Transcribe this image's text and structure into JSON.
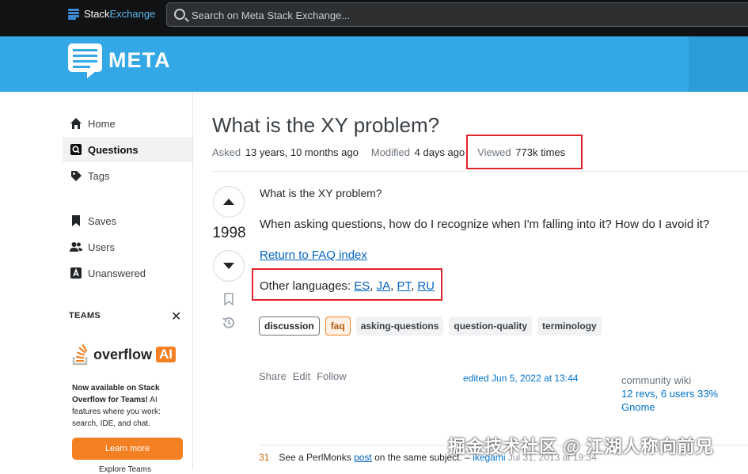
{
  "topbar": {
    "logo_stack": "Stack",
    "logo_exchange": "Exchange",
    "search_placeholder": "Search on Meta Stack Exchange..."
  },
  "banner": {
    "logo_text": "META"
  },
  "nav": {
    "items": [
      {
        "label": "Home",
        "icon": "home-icon"
      },
      {
        "label": "Questions",
        "icon": "questions-icon",
        "active": true
      },
      {
        "label": "Tags",
        "icon": "tag-icon"
      },
      {
        "label": "Saves",
        "icon": "bookmark-icon"
      },
      {
        "label": "Users",
        "icon": "users-icon"
      },
      {
        "label": "Unanswered",
        "icon": "unanswered-icon"
      }
    ],
    "teams_heading": "TEAMS",
    "overflow_word": "overflow",
    "overflow_ai": "AI",
    "teams_bold": "Now available on Stack Overflow for Teams!",
    "teams_body": " AI features where you work: search, IDE, and chat.",
    "learn_more": "Learn more",
    "explore": "Explore Teams"
  },
  "question": {
    "title": "What is the XY problem?",
    "asked_label": "Asked",
    "asked_value": "13 years, 10 months ago",
    "modified_label": "Modified",
    "modified_value": "4 days ago",
    "viewed_label": "Viewed",
    "viewed_value": "773k times",
    "votes": "1998",
    "line1": "What is the XY problem?",
    "line2": "When asking questions, how do I recognize when I'm falling into it? How do I avoid it?",
    "faq_link": "Return to FAQ index",
    "other_lang_label": "Other languages:",
    "lang_es": "ES",
    "lang_ja": "JA",
    "lang_pt": "PT",
    "lang_ru": "RU",
    "tags": [
      "discussion",
      "faq",
      "asking-questions",
      "question-quality",
      "terminology"
    ],
    "share": "Share",
    "edit": "Edit",
    "follow": "Follow",
    "edited": "edited Jun 5, 2022 at 13:44",
    "wiki_label": "community wiki",
    "wiki_revs": "12 revs, 6 users 33%",
    "wiki_user": "Gnome"
  },
  "comment": {
    "score": "31",
    "text_before": "See a PerlMonks ",
    "link": "post",
    "text_after": " on the same subject. – ",
    "user": "ikegami",
    "date": " Jul 31, 2013 at 19:34"
  },
  "watermark": "掘金技术社区 @ 江湖人称向前兄",
  "colors": {
    "banner": "#34a7e6",
    "highlight_box": "#e0242b",
    "accent_orange": "#f48024"
  }
}
